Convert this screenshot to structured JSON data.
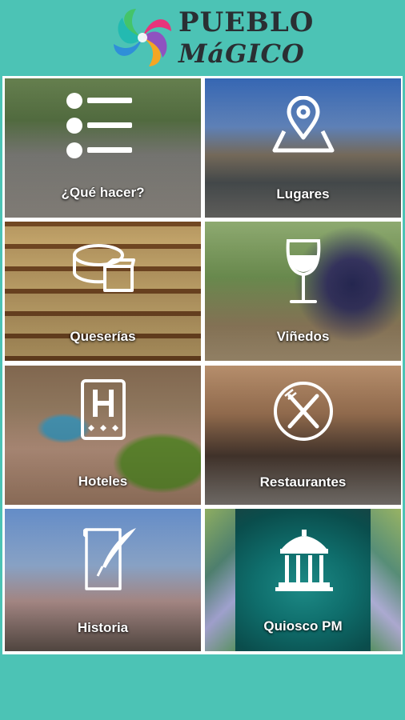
{
  "app": {
    "logo": {
      "line1": "PUEBLO",
      "line2": "MáGICO"
    }
  },
  "tiles": [
    {
      "label": "¿Qué hacer?",
      "icon": "list-icon"
    },
    {
      "label": "Lugares",
      "icon": "map-pin-icon"
    },
    {
      "label": "Queserías",
      "icon": "cheese-icon"
    },
    {
      "label": "Viñedos",
      "icon": "wine-glass-icon"
    },
    {
      "label": "Hoteles",
      "icon": "hotel-icon"
    },
    {
      "label": "Restaurantes",
      "icon": "restaurant-icon"
    },
    {
      "label": "Historia",
      "icon": "quill-document-icon"
    },
    {
      "label": "Quiosco PM",
      "icon": "gazebo-icon"
    }
  ],
  "colors": {
    "background": "#4cc3b5",
    "label_text": "#ffffff",
    "logo_text": "#2a2f33"
  }
}
